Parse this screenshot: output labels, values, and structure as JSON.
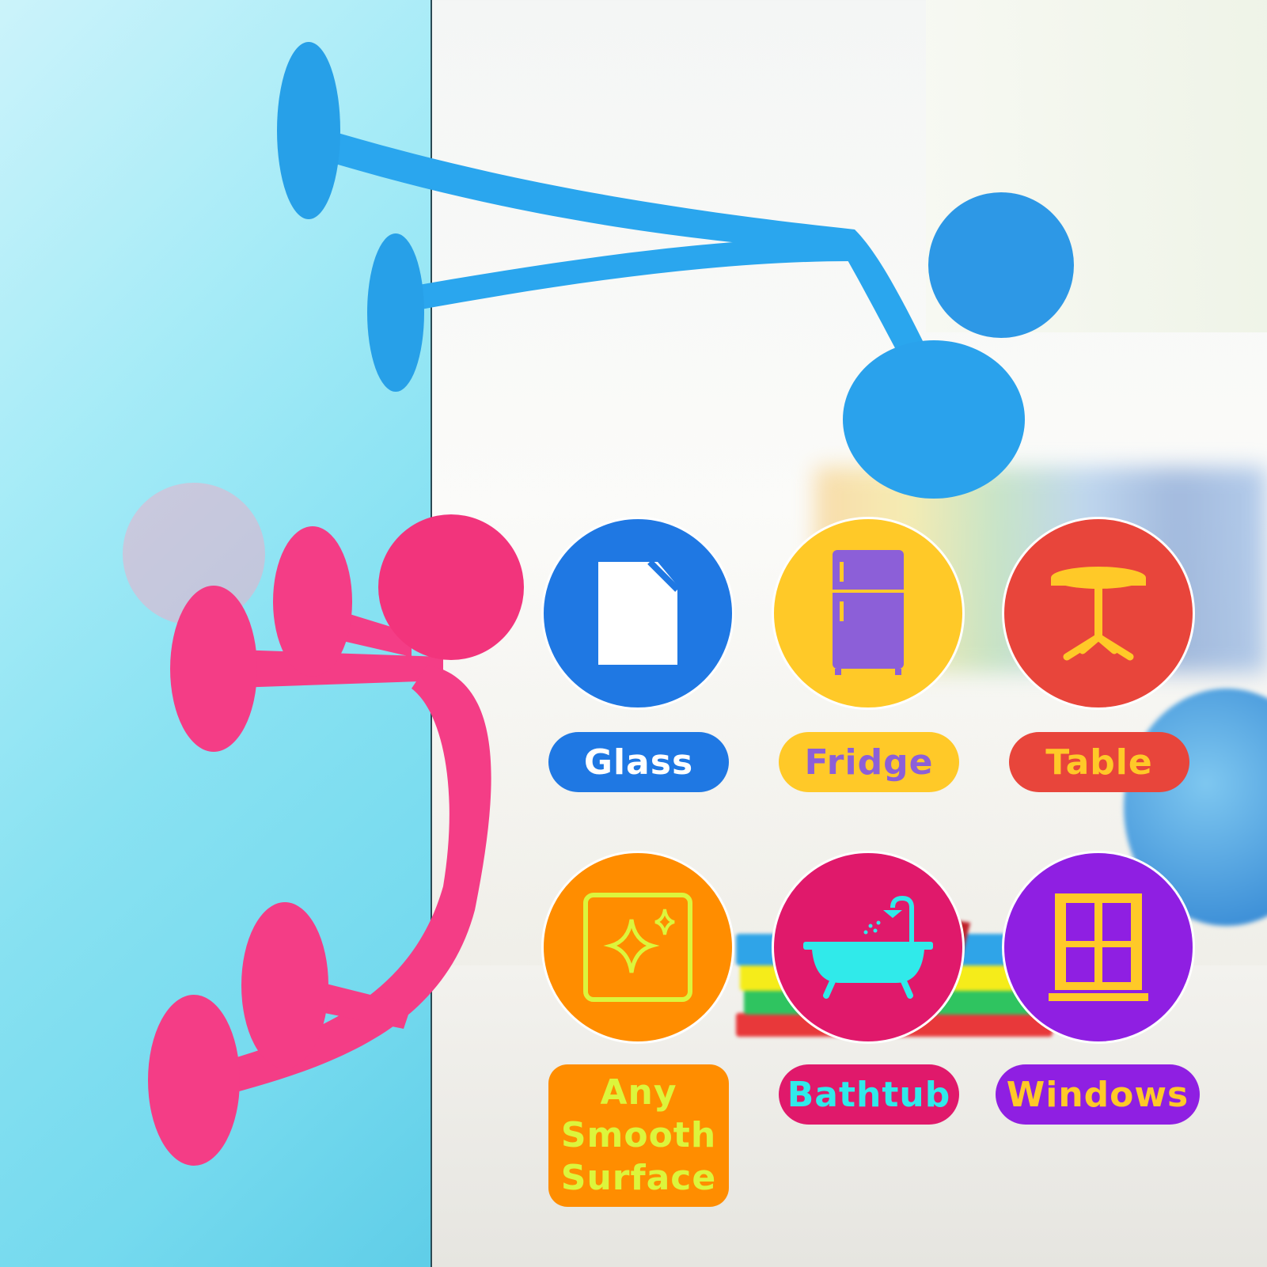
{
  "surfaces": [
    {
      "label": "Glass",
      "icon": "glass-pane-icon",
      "circle_color": "#1f78e3",
      "label_bg": "#1f78e3",
      "text_color": "#ffffff"
    },
    {
      "label": "Fridge",
      "icon": "fridge-icon",
      "circle_color": "#ffc928",
      "label_bg": "#ffc928",
      "text_color": "#8c5fd8"
    },
    {
      "label": "Table",
      "icon": "round-table-icon",
      "circle_color": "#e8453b",
      "label_bg": "#e8453b",
      "text_color": "#ffc928"
    },
    {
      "label_lines": [
        "Any",
        "Smooth",
        "Surface"
      ],
      "icon": "sparkle-surface-icon",
      "circle_color": "#ff8d00",
      "label_bg": "#ff8d00",
      "text_color": "#dcf53c"
    },
    {
      "label": "Bathtub",
      "icon": "bathtub-icon",
      "circle_color": "#e0196b",
      "label_bg": "#e0196b",
      "text_color": "#30eaea"
    },
    {
      "label": "Windows",
      "icon": "window-icon",
      "circle_color": "#8f1fe2",
      "label_bg": "#8f1fe2",
      "text_color": "#ffc928"
    }
  ],
  "toy_colors": {
    "blue": "#2aa6ee",
    "pink": "#f43d86"
  }
}
